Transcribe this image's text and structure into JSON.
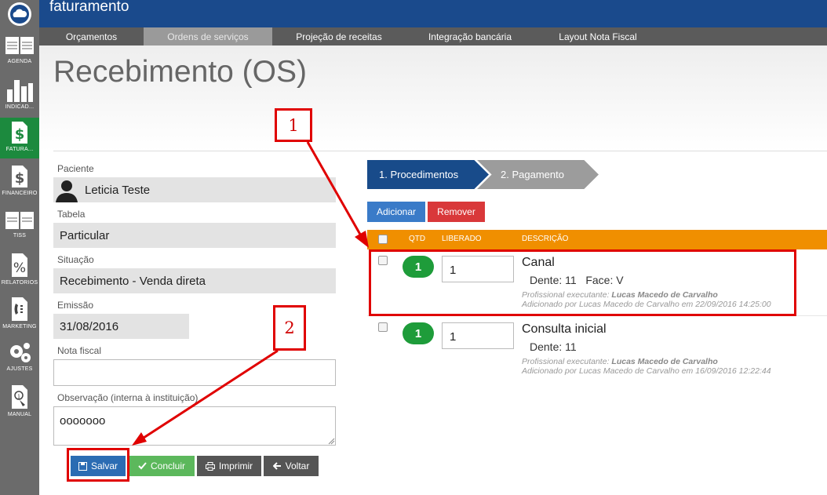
{
  "app": {
    "title": "faturamento"
  },
  "sidebar": {
    "items": [
      {
        "label": "AGENDA",
        "icon": "calendar-icon"
      },
      {
        "label": "INDICAD...",
        "icon": "bar-chart-icon"
      },
      {
        "label": "FATURA...",
        "icon": "dollar-icon"
      },
      {
        "label": "FINANCEIRO",
        "icon": "dollar-doc-icon"
      },
      {
        "label": "TISS",
        "icon": "tiss-icon"
      },
      {
        "label": "RELATORIOS",
        "icon": "percent-icon"
      },
      {
        "label": "MARKETING",
        "icon": "phone-icon"
      },
      {
        "label": "AJUSTES",
        "icon": "gears-icon"
      },
      {
        "label": "MANUAL",
        "icon": "manual-icon"
      }
    ]
  },
  "tabs": [
    "Orçamentos",
    "Ordens de serviços",
    "Projeção de receitas",
    "Integração bancária",
    "Layout Nota Fiscal"
  ],
  "page": {
    "title": "Recebimento (OS)"
  },
  "form": {
    "paciente_label": "Paciente",
    "paciente_value": "Leticia Teste",
    "tabela_label": "Tabela",
    "tabela_value": "Particular",
    "situacao_label": "Situação",
    "situacao_value": "Recebimento - Venda direta",
    "emissao_label": "Emissão",
    "emissao_value": "31/08/2016",
    "nota_label": "Nota fiscal",
    "nota_value": "",
    "obs_label": "Observação (interna à instituição)",
    "obs_value": "ooooooo"
  },
  "actions": {
    "salvar": "Salvar",
    "concluir": "Concluir",
    "imprimir": "Imprimir",
    "voltar": "Voltar"
  },
  "steps": [
    "1. Procedimentos",
    "2. Pagamento"
  ],
  "table_actions": {
    "add": "Adicionar",
    "remove": "Remover"
  },
  "table": {
    "headers": [
      "QTD",
      "LIBERADO",
      "DESCRIÇÃO"
    ],
    "rows": [
      {
        "qtd": "1",
        "liberado": "1",
        "title": "Canal",
        "detail": "Dente: 11   Face: V",
        "meta1_prefix": "Profissional executante: ",
        "meta1_name": "Lucas Macedo de Carvalho",
        "meta2": "Adicionado por Lucas Macedo de Carvalho em 22/09/2016 14:25:00"
      },
      {
        "qtd": "1",
        "liberado": "1",
        "title": "Consulta inicial",
        "detail": "Dente: 11",
        "meta1_prefix": "Profissional executante: ",
        "meta1_name": "Lucas Macedo de Carvalho",
        "meta2": "Adicionado por Lucas Macedo de Carvalho em 16/09/2016 12:22:44"
      }
    ]
  },
  "annotations": {
    "one": "1",
    "two": "2"
  },
  "colors": {
    "topbar": "#1a4a8c",
    "accent_green": "#1e9c3a",
    "table_header": "#f08f00",
    "annotation": "#e00000"
  }
}
